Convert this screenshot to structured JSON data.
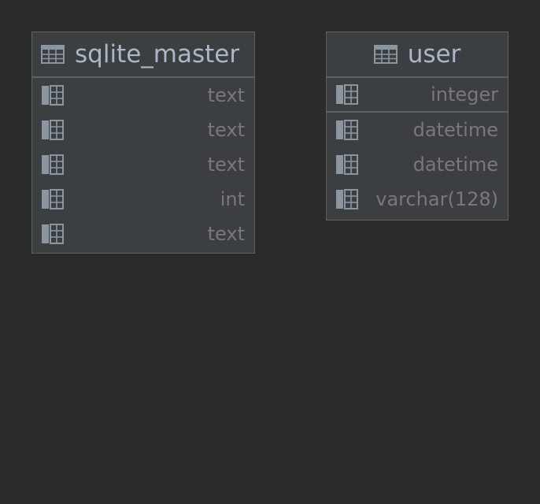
{
  "tables": [
    {
      "name": "sqlite_master",
      "columns": [
        {
          "type": "text"
        },
        {
          "type": "text"
        },
        {
          "type": "text"
        },
        {
          "type": "int"
        },
        {
          "type": "text"
        }
      ]
    },
    {
      "name": "user",
      "columns": [
        {
          "type": "integer",
          "primary_key": true
        },
        {
          "type": "datetime"
        },
        {
          "type": "datetime"
        },
        {
          "type": "varchar(128)"
        }
      ]
    }
  ],
  "icons": {
    "table": "table-grid-icon",
    "column": "column-icon"
  },
  "colors": {
    "background": "#2b2b2b",
    "box": "#3c3f41",
    "border": "#5d6266",
    "title": "#a9b7c6",
    "type_text": "#787878",
    "icon": "#8c96a0"
  }
}
